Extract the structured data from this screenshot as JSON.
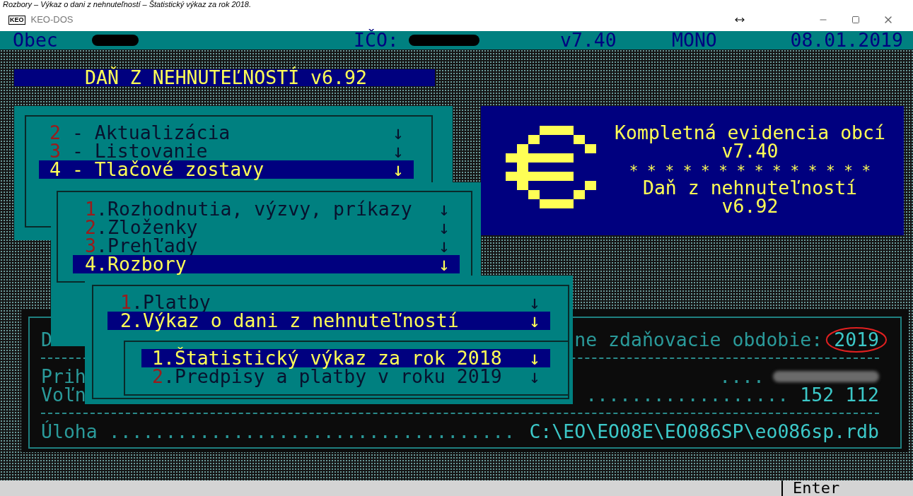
{
  "caption": "Rozbory – Výkaz o dani z nehnuteľností – Štatistický výkaz za rok 2018.",
  "window": {
    "icon_text": "KEO",
    "title": "KEO-DOS"
  },
  "top_bar": {
    "municipality_label": "Obec",
    "municipality_redacted": true,
    "ico_label": "IČO:",
    "ico_redacted": true,
    "version": "v7.40",
    "mode": "MONO",
    "date": "08.01.2019"
  },
  "app_title": "DAŇ Z NEHNUTEĽNOSTÍ v6.92",
  "splash": {
    "lines": [
      "Kompletná evidencia obcí",
      "v7.40",
      "* * * * * * * * * * * * * *",
      "Daň z nehnuteľností",
      "v6.92"
    ]
  },
  "info_panel": {
    "rows": [
      {
        "kind": "row",
        "left": "D",
        "right": "ne zdaňovacie obdobie:",
        "value": "2019",
        "circled": true
      },
      {
        "kind": "rule"
      },
      {
        "kind": "row",
        "left": "Prih",
        "right": "....",
        "redacted": true
      },
      {
        "kind": "row",
        "left": "Voľn",
        "right": "..................",
        "value": "152 112"
      },
      {
        "kind": "rule"
      },
      {
        "kind": "row",
        "left": "Úloha ....................................",
        "value": "C:\\EO\\EO08E\\EO086SP\\eo086sp.rdb"
      }
    ]
  },
  "menus": [
    {
      "items": [
        {
          "hotkey": "2",
          "label": "- Aktualizácia",
          "arrow": "↓",
          "selected": false
        },
        {
          "hotkey": "3",
          "label": "- Listovanie",
          "arrow": "↓",
          "selected": false
        },
        {
          "hotkey": "4",
          "label": "- Tlačové zostavy",
          "arrow": "↓",
          "selected": true
        }
      ]
    },
    {
      "items": [
        {
          "hotkey": "1",
          "label": ".Rozhodnutia, výzvy, príkazy",
          "arrow": "↓",
          "selected": false
        },
        {
          "hotkey": "2",
          "label": ".Zloženky",
          "arrow": "↓",
          "selected": false
        },
        {
          "hotkey": "3",
          "label": ".Prehľady",
          "arrow": "↓",
          "selected": false
        },
        {
          "hotkey": "4",
          "label": ".Rozbory",
          "arrow": "↓",
          "selected": true
        }
      ]
    },
    {
      "items": [
        {
          "hotkey": "1",
          "label": ".Platby",
          "arrow": "↓",
          "selected": false
        },
        {
          "hotkey": "2",
          "label": ".Výkaz o dani z nehnuteľností",
          "arrow": "↓",
          "selected": true
        }
      ]
    },
    {
      "items": [
        {
          "hotkey": "1",
          "label": ".Štatistický výkaz za rok 2018",
          "arrow": "↓",
          "selected": true
        },
        {
          "hotkey": "2",
          "label": ".Predpisy a platby v roku 2019",
          "arrow": "↓",
          "selected": false
        }
      ]
    }
  ],
  "status_bar": {
    "key": "Enter"
  }
}
